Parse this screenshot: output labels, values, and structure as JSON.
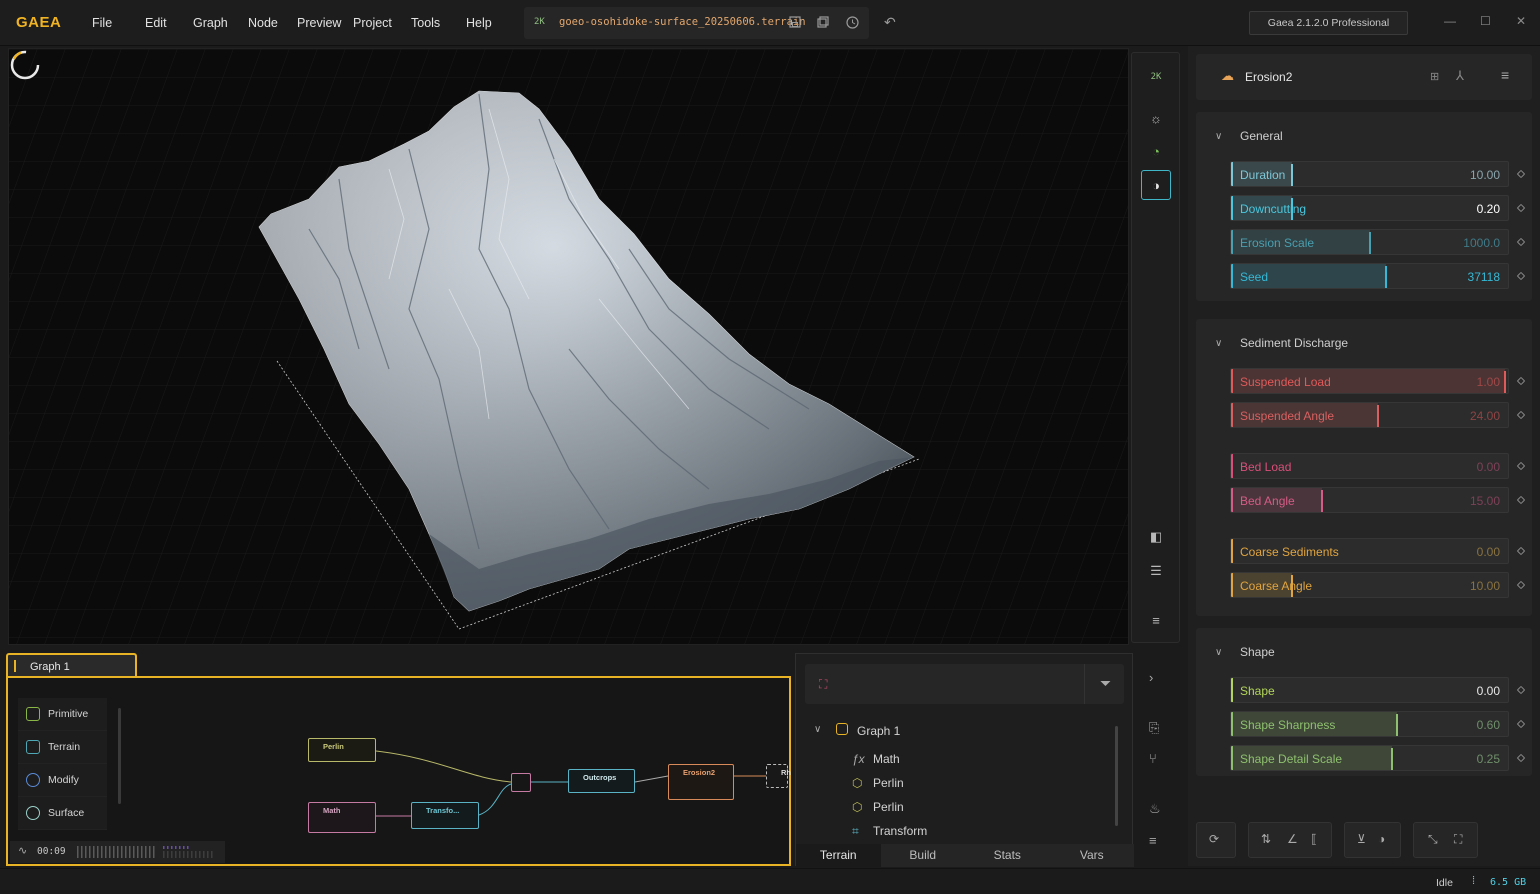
{
  "app": {
    "logo": "GAEA",
    "menu": [
      "File",
      "Edit",
      "Graph",
      "Node",
      "Preview",
      "Project",
      "Tools",
      "Help"
    ],
    "resolution_badge": "2K",
    "file_name": "goeo-osohidoke-surface_20250606.terrain",
    "version": "Gaea 2.1.2.0 Professional"
  },
  "viewport": {
    "resolution_badge": "2K"
  },
  "graph": {
    "tab_label": "Graph 1",
    "palette": [
      {
        "label": "Primitive",
        "color": "#8ab547"
      },
      {
        "label": "Terrain",
        "color": "#4fa8b5"
      },
      {
        "label": "Modify",
        "color": "#5a8ad6"
      },
      {
        "label": "Surface",
        "color": "#9ad0c8"
      }
    ],
    "timer": "00:09",
    "nodes": {
      "perlin": "Perlin",
      "math": "Math",
      "transform": "Transfo...",
      "outcrops": "Outcrops",
      "erosion2": "Erosion2",
      "rh": "Rh"
    }
  },
  "tree": {
    "root": "Graph 1",
    "items": [
      {
        "icon": "fx",
        "label": "Math"
      },
      {
        "icon": "hex",
        "label": "Perlin"
      },
      {
        "icon": "hex",
        "label": "Perlin"
      },
      {
        "icon": "transform",
        "label": "Transform"
      }
    ],
    "tabs": [
      "Terrain",
      "Build",
      "Stats",
      "Vars"
    ]
  },
  "properties": {
    "node_name": "Erosion2",
    "sections": {
      "general": "General",
      "sediment": "Sediment Discharge",
      "shape": "Shape"
    },
    "general": [
      {
        "label": "Duration",
        "value": "10.00",
        "fill": 0.22,
        "color": "#7dc7d6",
        "valcolor": "#8aa5ad"
      },
      {
        "label": "Downcutting",
        "value": "0.20",
        "fill": 0.22,
        "color": "#4bc7de",
        "valcolor": "#ffffff"
      },
      {
        "label": "Erosion Scale",
        "value": "1000.0",
        "fill": 0.5,
        "color": "#4a9fb0",
        "valcolor": "#3f7a88"
      },
      {
        "label": "Seed",
        "value": "37118",
        "fill": 0.56,
        "color": "#35b9d6",
        "valcolor": "#35b9d6"
      }
    ],
    "sediment": [
      {
        "label": "Suspended Load",
        "value": "1.00",
        "fill": 0.99,
        "color": "#e05a5a",
        "valcolor": "#a04848"
      },
      {
        "label": "Suspended Angle",
        "value": "24.00",
        "fill": 0.53,
        "color": "#d96060",
        "valcolor": "#8e4444"
      },
      {
        "label": "Bed Load",
        "value": "0.00",
        "fill": 0.0,
        "color": "#d94f7a",
        "valcolor": "#7d4157"
      },
      {
        "label": "Bed Angle",
        "value": "15.00",
        "fill": 0.33,
        "color": "#d55c86",
        "valcolor": "#7d4157"
      },
      {
        "label": "Coarse Sediments",
        "value": "0.00",
        "fill": 0.0,
        "color": "#e0a540",
        "valcolor": "#8a7240"
      },
      {
        "label": "Coarse Angle",
        "value": "10.00",
        "fill": 0.22,
        "color": "#e0a540",
        "valcolor": "#8a7240"
      }
    ],
    "shape": [
      {
        "label": "Shape",
        "value": "0.00",
        "fill": 0.0,
        "color": "#b3d65a",
        "valcolor": "#e8e8e8"
      },
      {
        "label": "Shape Sharpness",
        "value": "0.60",
        "fill": 0.6,
        "color": "#8fc06f",
        "valcolor": "#6f8f6a"
      },
      {
        "label": "Shape Detail Scale",
        "value": "0.25",
        "fill": 0.58,
        "color": "#8fc06f",
        "valcolor": "#6f8f6a"
      }
    ]
  },
  "status": {
    "state": "Idle",
    "memory": "6.5 GB"
  }
}
